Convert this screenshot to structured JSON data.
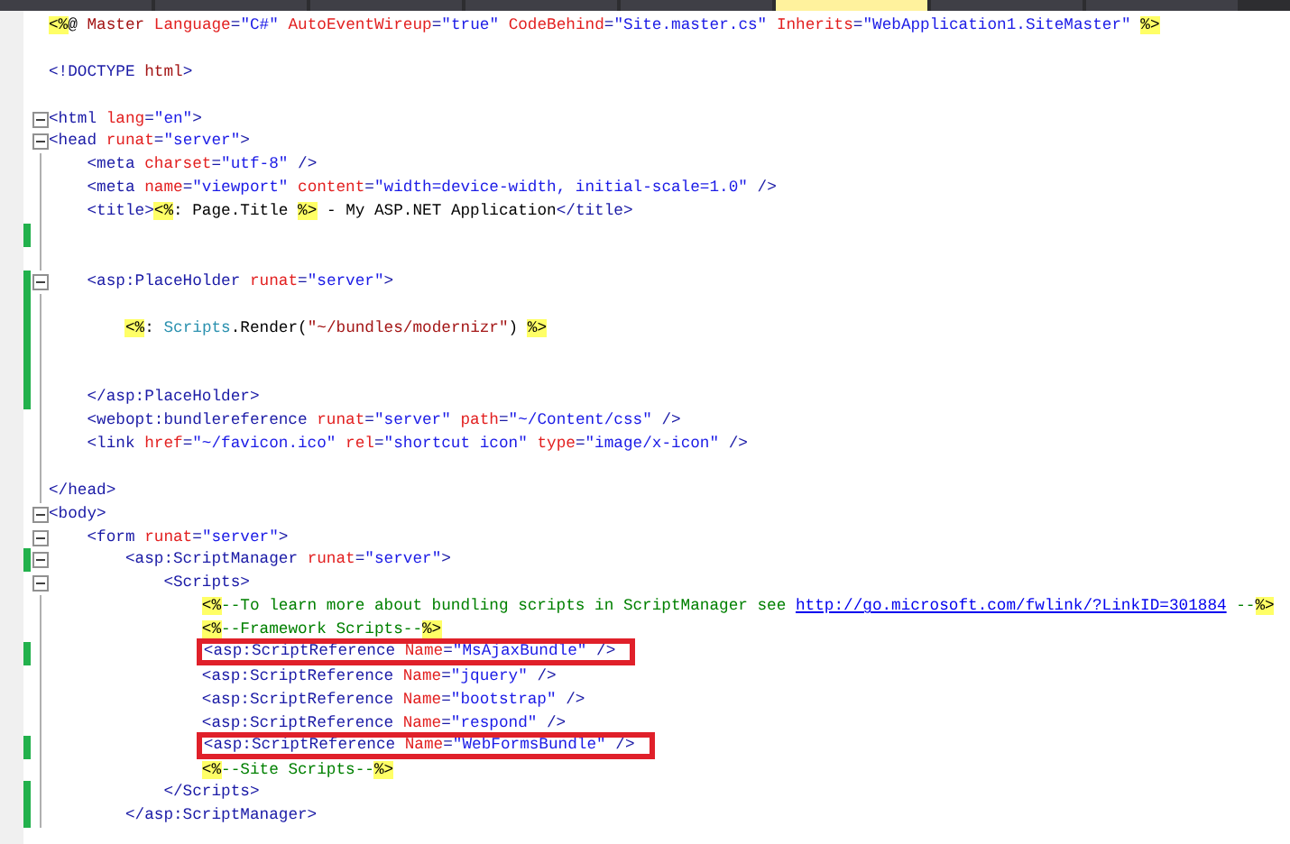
{
  "tabs": [
    {
      "selected": false
    },
    {
      "selected": false
    },
    {
      "selected": false
    },
    {
      "selected": false
    },
    {
      "selected": false
    },
    {
      "selected": true
    },
    {
      "selected": false
    },
    {
      "selected": false
    }
  ],
  "lines": [
    {
      "changed": false,
      "collapsible": false,
      "boxed": false,
      "tokens": [
        {
          "kind": "delim",
          "text": "<%"
        },
        {
          "kind": "plain",
          "text": "@ "
        },
        {
          "kind": "directive",
          "text": "Master"
        },
        {
          "kind": "attr",
          "text": " Language"
        },
        {
          "kind": "tag",
          "text": "="
        },
        {
          "kind": "value",
          "text": "\"C#\""
        },
        {
          "kind": "attr",
          "text": " AutoEventWireup"
        },
        {
          "kind": "tag",
          "text": "="
        },
        {
          "kind": "value",
          "text": "\"true\""
        },
        {
          "kind": "attr",
          "text": " CodeBehind"
        },
        {
          "kind": "tag",
          "text": "="
        },
        {
          "kind": "value",
          "text": "\"Site.master.cs\""
        },
        {
          "kind": "attr",
          "text": " Inherits"
        },
        {
          "kind": "tag",
          "text": "="
        },
        {
          "kind": "value",
          "text": "\"WebApplication1.SiteMaster\" "
        },
        {
          "kind": "delim",
          "text": "%>"
        }
      ]
    },
    {
      "changed": false,
      "collapsible": false,
      "boxed": false
    },
    {
      "changed": false,
      "collapsible": false,
      "boxed": false,
      "tokens": [
        {
          "kind": "tag",
          "text": "<!DOCTYPE "
        },
        {
          "kind": "directive",
          "text": "html"
        },
        {
          "kind": "tag",
          "text": ">"
        }
      ]
    },
    {
      "changed": false,
      "collapsible": false,
      "boxed": false
    },
    {
      "changed": false,
      "collapsible": true,
      "boxed": false,
      "tokens": [
        {
          "kind": "tag",
          "text": "<html "
        },
        {
          "kind": "attr",
          "text": "lang"
        },
        {
          "kind": "tag",
          "text": "="
        },
        {
          "kind": "value",
          "text": "\"en\""
        },
        {
          "kind": "tag",
          "text": ">"
        }
      ]
    },
    {
      "changed": false,
      "collapsible": true,
      "boxed": false,
      "tokens": [
        {
          "kind": "tag",
          "text": "<head "
        },
        {
          "kind": "attr",
          "text": "runat"
        },
        {
          "kind": "tag",
          "text": "="
        },
        {
          "kind": "value",
          "text": "\"server\""
        },
        {
          "kind": "tag",
          "text": ">"
        }
      ]
    },
    {
      "changed": false,
      "collapsible": false,
      "boxed": false,
      "tokens": [
        {
          "kind": "tag",
          "text": "    <meta "
        },
        {
          "kind": "attr",
          "text": "charset"
        },
        {
          "kind": "tag",
          "text": "="
        },
        {
          "kind": "value",
          "text": "\"utf-8\""
        },
        {
          "kind": "tag",
          "text": " />"
        }
      ]
    },
    {
      "changed": false,
      "collapsible": false,
      "boxed": false,
      "tokens": [
        {
          "kind": "tag",
          "text": "    <meta "
        },
        {
          "kind": "attr",
          "text": "name"
        },
        {
          "kind": "tag",
          "text": "="
        },
        {
          "kind": "value",
          "text": "\"viewport\""
        },
        {
          "kind": "attr",
          "text": " content"
        },
        {
          "kind": "tag",
          "text": "="
        },
        {
          "kind": "value",
          "text": "\"width=device-width, initial-scale=1.0\""
        },
        {
          "kind": "tag",
          "text": " />"
        }
      ]
    },
    {
      "changed": false,
      "collapsible": false,
      "boxed": false,
      "tokens": [
        {
          "kind": "tag",
          "text": "    <title>"
        },
        {
          "kind": "delim",
          "text": "<%"
        },
        {
          "kind": "plain",
          "text": ": Page.Title "
        },
        {
          "kind": "delim",
          "text": "%>"
        },
        {
          "kind": "plain",
          "text": " - My ASP.NET Application"
        },
        {
          "kind": "tag",
          "text": "</title>"
        }
      ]
    },
    {
      "changed": true,
      "collapsible": false,
      "boxed": false
    },
    {
      "changed": false,
      "collapsible": false,
      "boxed": false
    },
    {
      "changed": true,
      "collapsible": true,
      "boxed": false,
      "tokens": [
        {
          "kind": "tag",
          "text": "    <asp:PlaceHolder "
        },
        {
          "kind": "attr",
          "text": "runat"
        },
        {
          "kind": "tag",
          "text": "="
        },
        {
          "kind": "value",
          "text": "\"server\""
        },
        {
          "kind": "tag",
          "text": ">"
        }
      ]
    },
    {
      "changed": true,
      "collapsible": false,
      "boxed": false
    },
    {
      "changed": true,
      "collapsible": false,
      "boxed": false,
      "tokens": [
        {
          "kind": "delim",
          "text": "        <%"
        },
        {
          "kind": "plain",
          "text": ": "
        },
        {
          "kind": "keyword",
          "text": "Scripts"
        },
        {
          "kind": "plain",
          "text": ".Render("
        },
        {
          "kind": "string",
          "text": "\"~/bundles/modernizr\""
        },
        {
          "kind": "plain",
          "text": ") "
        },
        {
          "kind": "delim",
          "text": "%>"
        }
      ]
    },
    {
      "changed": true,
      "collapsible": false,
      "boxed": false
    },
    {
      "changed": true,
      "collapsible": false,
      "boxed": false
    },
    {
      "changed": true,
      "collapsible": false,
      "boxed": false,
      "tokens": [
        {
          "kind": "tag",
          "text": "    </asp:PlaceHolder>"
        }
      ]
    },
    {
      "changed": false,
      "collapsible": false,
      "boxed": false,
      "tokens": [
        {
          "kind": "tag",
          "text": "    <webopt:bundlereference "
        },
        {
          "kind": "attr",
          "text": "runat"
        },
        {
          "kind": "tag",
          "text": "="
        },
        {
          "kind": "value",
          "text": "\"server\""
        },
        {
          "kind": "attr",
          "text": " path"
        },
        {
          "kind": "tag",
          "text": "="
        },
        {
          "kind": "value",
          "text": "\"~/Content/css\""
        },
        {
          "kind": "tag",
          "text": " />"
        }
      ]
    },
    {
      "changed": false,
      "collapsible": false,
      "boxed": false,
      "tokens": [
        {
          "kind": "tag",
          "text": "    <link "
        },
        {
          "kind": "attr",
          "text": "href"
        },
        {
          "kind": "tag",
          "text": "="
        },
        {
          "kind": "value",
          "text": "\"~/favicon.ico\""
        },
        {
          "kind": "attr",
          "text": " rel"
        },
        {
          "kind": "tag",
          "text": "="
        },
        {
          "kind": "value",
          "text": "\"shortcut icon\""
        },
        {
          "kind": "attr",
          "text": " type"
        },
        {
          "kind": "tag",
          "text": "="
        },
        {
          "kind": "value",
          "text": "\"image/x-icon\""
        },
        {
          "kind": "tag",
          "text": " />"
        }
      ]
    },
    {
      "changed": false,
      "collapsible": false,
      "boxed": false
    },
    {
      "changed": false,
      "collapsible": false,
      "boxed": false,
      "tokens": [
        {
          "kind": "tag",
          "text": "</head>"
        }
      ]
    },
    {
      "changed": false,
      "collapsible": true,
      "boxed": false,
      "tokens": [
        {
          "kind": "tag",
          "text": "<body>"
        }
      ]
    },
    {
      "changed": false,
      "collapsible": true,
      "boxed": false,
      "tokens": [
        {
          "kind": "tag",
          "text": "    <form "
        },
        {
          "kind": "attr",
          "text": "runat"
        },
        {
          "kind": "tag",
          "text": "="
        },
        {
          "kind": "value",
          "text": "\"server\""
        },
        {
          "kind": "tag",
          "text": ">"
        }
      ]
    },
    {
      "changed": true,
      "collapsible": true,
      "boxed": false,
      "tokens": [
        {
          "kind": "tag",
          "text": "        <asp:ScriptManager "
        },
        {
          "kind": "attr",
          "text": "runat"
        },
        {
          "kind": "tag",
          "text": "="
        },
        {
          "kind": "value",
          "text": "\"server\""
        },
        {
          "kind": "tag",
          "text": ">"
        }
      ]
    },
    {
      "changed": false,
      "collapsible": true,
      "boxed": false,
      "tokens": [
        {
          "kind": "tag",
          "text": "            <Scripts>"
        }
      ]
    },
    {
      "changed": false,
      "collapsible": false,
      "boxed": false,
      "tokens": [
        {
          "kind": "delim",
          "text": "                <%"
        },
        {
          "kind": "comment",
          "text": "--To learn more about bundling scripts in ScriptManager see "
        },
        {
          "kind": "link",
          "text": "http://go.microsoft.com/fwlink/?LinkID=301884"
        },
        {
          "kind": "comment",
          "text": " --"
        },
        {
          "kind": "delim",
          "text": "%>"
        }
      ]
    },
    {
      "changed": false,
      "collapsible": false,
      "boxed": false,
      "tokens": [
        {
          "kind": "delim",
          "text": "                <%"
        },
        {
          "kind": "comment",
          "text": "--Framework Scripts--"
        },
        {
          "kind": "delim",
          "text": "%>"
        }
      ]
    },
    {
      "changed": true,
      "collapsible": false,
      "boxed": true,
      "tokens": [
        {
          "kind": "tag",
          "text": "                <asp:ScriptReference "
        },
        {
          "kind": "attr",
          "text": "Name"
        },
        {
          "kind": "tag",
          "text": "="
        },
        {
          "kind": "value",
          "text": "\"MsAjaxBundle\""
        },
        {
          "kind": "tag",
          "text": " />"
        }
      ]
    },
    {
      "changed": false,
      "collapsible": false,
      "boxed": false,
      "tokens": [
        {
          "kind": "tag",
          "text": "                <asp:ScriptReference "
        },
        {
          "kind": "attr",
          "text": "Name"
        },
        {
          "kind": "tag",
          "text": "="
        },
        {
          "kind": "value",
          "text": "\"jquery\""
        },
        {
          "kind": "tag",
          "text": " />"
        }
      ]
    },
    {
      "changed": false,
      "collapsible": false,
      "boxed": false,
      "tokens": [
        {
          "kind": "tag",
          "text": "                <asp:ScriptReference "
        },
        {
          "kind": "attr",
          "text": "Name"
        },
        {
          "kind": "tag",
          "text": "="
        },
        {
          "kind": "value",
          "text": "\"bootstrap\""
        },
        {
          "kind": "tag",
          "text": " />"
        }
      ]
    },
    {
      "changed": false,
      "collapsible": false,
      "boxed": false,
      "tokens": [
        {
          "kind": "tag",
          "text": "                <asp:ScriptReference "
        },
        {
          "kind": "attr",
          "text": "Name"
        },
        {
          "kind": "tag",
          "text": "="
        },
        {
          "kind": "value",
          "text": "\"respond\""
        },
        {
          "kind": "tag",
          "text": " />"
        }
      ]
    },
    {
      "changed": true,
      "collapsible": false,
      "boxed": true,
      "tokens": [
        {
          "kind": "tag",
          "text": "                <asp:ScriptReference "
        },
        {
          "kind": "attr",
          "text": "Name"
        },
        {
          "kind": "tag",
          "text": "="
        },
        {
          "kind": "value",
          "text": "\"WebFormsBundle\""
        },
        {
          "kind": "tag",
          "text": " />"
        }
      ]
    },
    {
      "changed": false,
      "collapsible": false,
      "boxed": false,
      "tokens": [
        {
          "kind": "delim",
          "text": "                <%"
        },
        {
          "kind": "comment",
          "text": "--Site Scripts--"
        },
        {
          "kind": "delim",
          "text": "%>"
        }
      ]
    },
    {
      "changed": true,
      "collapsible": false,
      "boxed": false,
      "tokens": [
        {
          "kind": "tag",
          "text": "            </Scripts>"
        }
      ]
    },
    {
      "changed": true,
      "collapsible": false,
      "boxed": false,
      "tokens": [
        {
          "kind": "tag",
          "text": "        </asp:ScriptManager>"
        }
      ]
    }
  ]
}
